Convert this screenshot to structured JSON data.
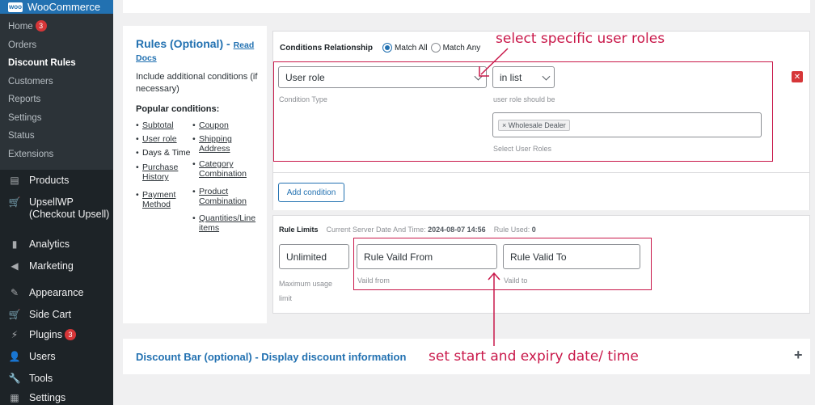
{
  "sidebar": {
    "brand": "WooCommerce",
    "submenu": [
      {
        "label": "Home",
        "badge": "3"
      },
      {
        "label": "Orders"
      },
      {
        "label": "Discount Rules",
        "active": true
      },
      {
        "label": "Customers"
      },
      {
        "label": "Reports"
      },
      {
        "label": "Settings"
      },
      {
        "label": "Status"
      },
      {
        "label": "Extensions"
      }
    ],
    "menu": [
      {
        "label": "Products",
        "icon": "products-icon"
      },
      {
        "label": "UpsellWP (Checkout Upsell)",
        "icon": "cart-icon"
      },
      {
        "label": "Analytics",
        "icon": "analytics-icon"
      },
      {
        "label": "Marketing",
        "icon": "megaphone-icon"
      },
      {
        "label": "Appearance",
        "icon": "brush-icon"
      },
      {
        "label": "Side Cart",
        "icon": "cart-icon"
      },
      {
        "label": "Plugins",
        "icon": "plug-icon",
        "badge": "3"
      },
      {
        "label": "Users",
        "icon": "users-icon"
      },
      {
        "label": "Tools",
        "icon": "wrench-icon"
      },
      {
        "label": "Settings",
        "icon": "settings-icon"
      }
    ]
  },
  "rules": {
    "title": "Rules (Optional) - ",
    "docs_link": "Read Docs",
    "description": "Include additional conditions (if necessary)",
    "popular_label": "Popular conditions:",
    "conditions": {
      "subtotal": "Subtotal",
      "user_role": "User role",
      "days_time": "Days & Time",
      "purchase_history": "Purchase History",
      "payment_method": "Payment Method",
      "coupon": "Coupon",
      "shipping_address": "Shipping Address",
      "category_combination": "Category Combination",
      "product_combination": "Product Combination",
      "quantities": "Quantities/Line items"
    }
  },
  "conditions_panel": {
    "relationship_label": "Conditions Relationship",
    "match_all": "Match All",
    "match_any": "Match Any",
    "condition_type_value": "User role",
    "condition_type_hint": "Condition Type",
    "operator_value": "in list",
    "operator_hint": "user role should be",
    "selected_role": "× Wholesale Dealer",
    "roles_hint": "Select User Roles",
    "delete_glyph": "✕",
    "add_condition": "Add condition"
  },
  "limits": {
    "label": "Rule Limits",
    "server_time_label": "Current Server Date And Time:",
    "server_time": "2024-08-07 14:56",
    "rule_used_label": "Rule Used:",
    "rule_used": "0",
    "usage_value": "Unlimited",
    "usage_hint": "Maximum usage limit",
    "from_placeholder": "Rule Vaild From",
    "from_hint": "Vaild from",
    "to_placeholder": "Rule Valid To",
    "to_hint": "Vaild to"
  },
  "discount_bar": {
    "title": "Discount Bar (optional) - Display discount information",
    "expand_glyph": "+"
  },
  "annotations": {
    "roles_note": "select specific user roles",
    "dates_note": "set start and expiry date/ time",
    "color": "#c9184a"
  }
}
